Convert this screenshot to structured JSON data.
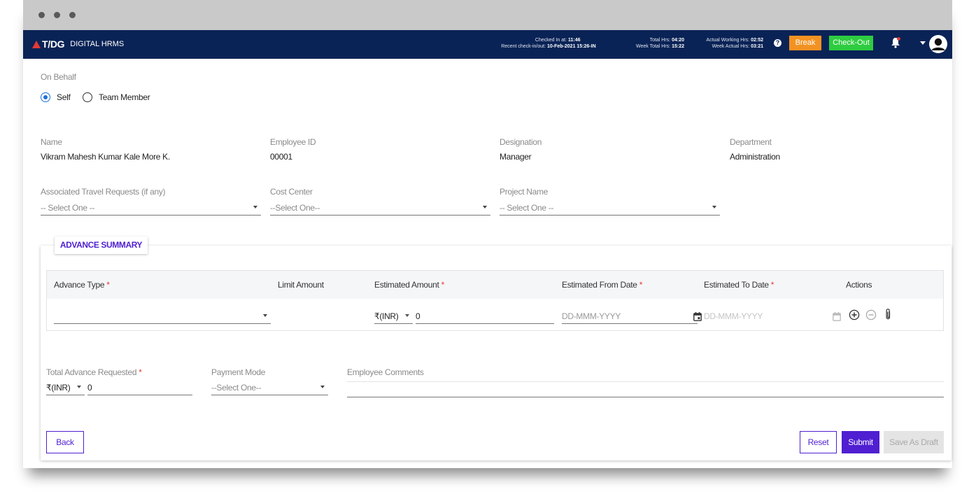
{
  "header": {
    "brand": "T/DG",
    "app_name": "DIGITAL HRMS",
    "checked_in_label": "Checked In at:",
    "checked_in_value": "11:46",
    "recent_label": "Recent check-in/out:",
    "recent_value": "10-Feb-2021 15:26-IN",
    "total_hrs_label": "Total Hrs:",
    "total_hrs_value": "04:20",
    "week_total_label": "Week Total Hrs:",
    "week_total_value": "15:22",
    "actual_working_label": "Actual Working Hrs:",
    "actual_working_value": "02:52",
    "week_actual_label": "Week Actual Hrs:",
    "week_actual_value": "03:21",
    "help_glyph": "?",
    "break_label": "Break",
    "checkout_label": "Check-Out",
    "colors": {
      "bar": "#0a2356",
      "break": "#f39222",
      "checkout": "#2ecc40",
      "accent": "#4f1fd1"
    }
  },
  "on_behalf": {
    "label": "On Behalf",
    "options": [
      "Self",
      "Team Member"
    ],
    "selected": "Self"
  },
  "employee": {
    "name_label": "Name",
    "name_value": "Vikram Mahesh Kumar Kale More K.",
    "id_label": "Employee ID",
    "id_value": "00001",
    "designation_label": "Designation",
    "designation_value": "Manager",
    "department_label": "Department",
    "department_value": "Administration"
  },
  "filters": {
    "travel_label": "Associated Travel Requests (if any)",
    "travel_placeholder": "-- Select One --",
    "cost_label": "Cost Center",
    "cost_placeholder": "--Select One--",
    "project_label": "Project Name",
    "project_placeholder": "-- Select One --"
  },
  "advance_summary": {
    "title": "ADVANCE SUMMARY",
    "columns": {
      "advance_type": "Advance Type",
      "limit_amount": "Limit Amount",
      "estimated_amount": "Estimated Amount",
      "from_date": "Estimated From Date",
      "to_date": "Estimated To Date",
      "actions": "Actions"
    },
    "required_mark": "*",
    "row": {
      "advance_type": "",
      "currency": "₹(INR)",
      "amount": "0",
      "from_placeholder": "DD-MMM-YYYY",
      "to_placeholder": "DD-MMM-YYYY"
    }
  },
  "totals": {
    "total_label": "Total Advance Requested",
    "currency": "₹(INR)",
    "total_value": "0",
    "payment_label": "Payment Mode",
    "payment_placeholder": "--Select One--",
    "comments_label": "Employee Comments",
    "comments_value": ""
  },
  "buttons": {
    "back": "Back",
    "reset": "Reset",
    "submit": "Submit",
    "draft": "Save As Draft"
  }
}
